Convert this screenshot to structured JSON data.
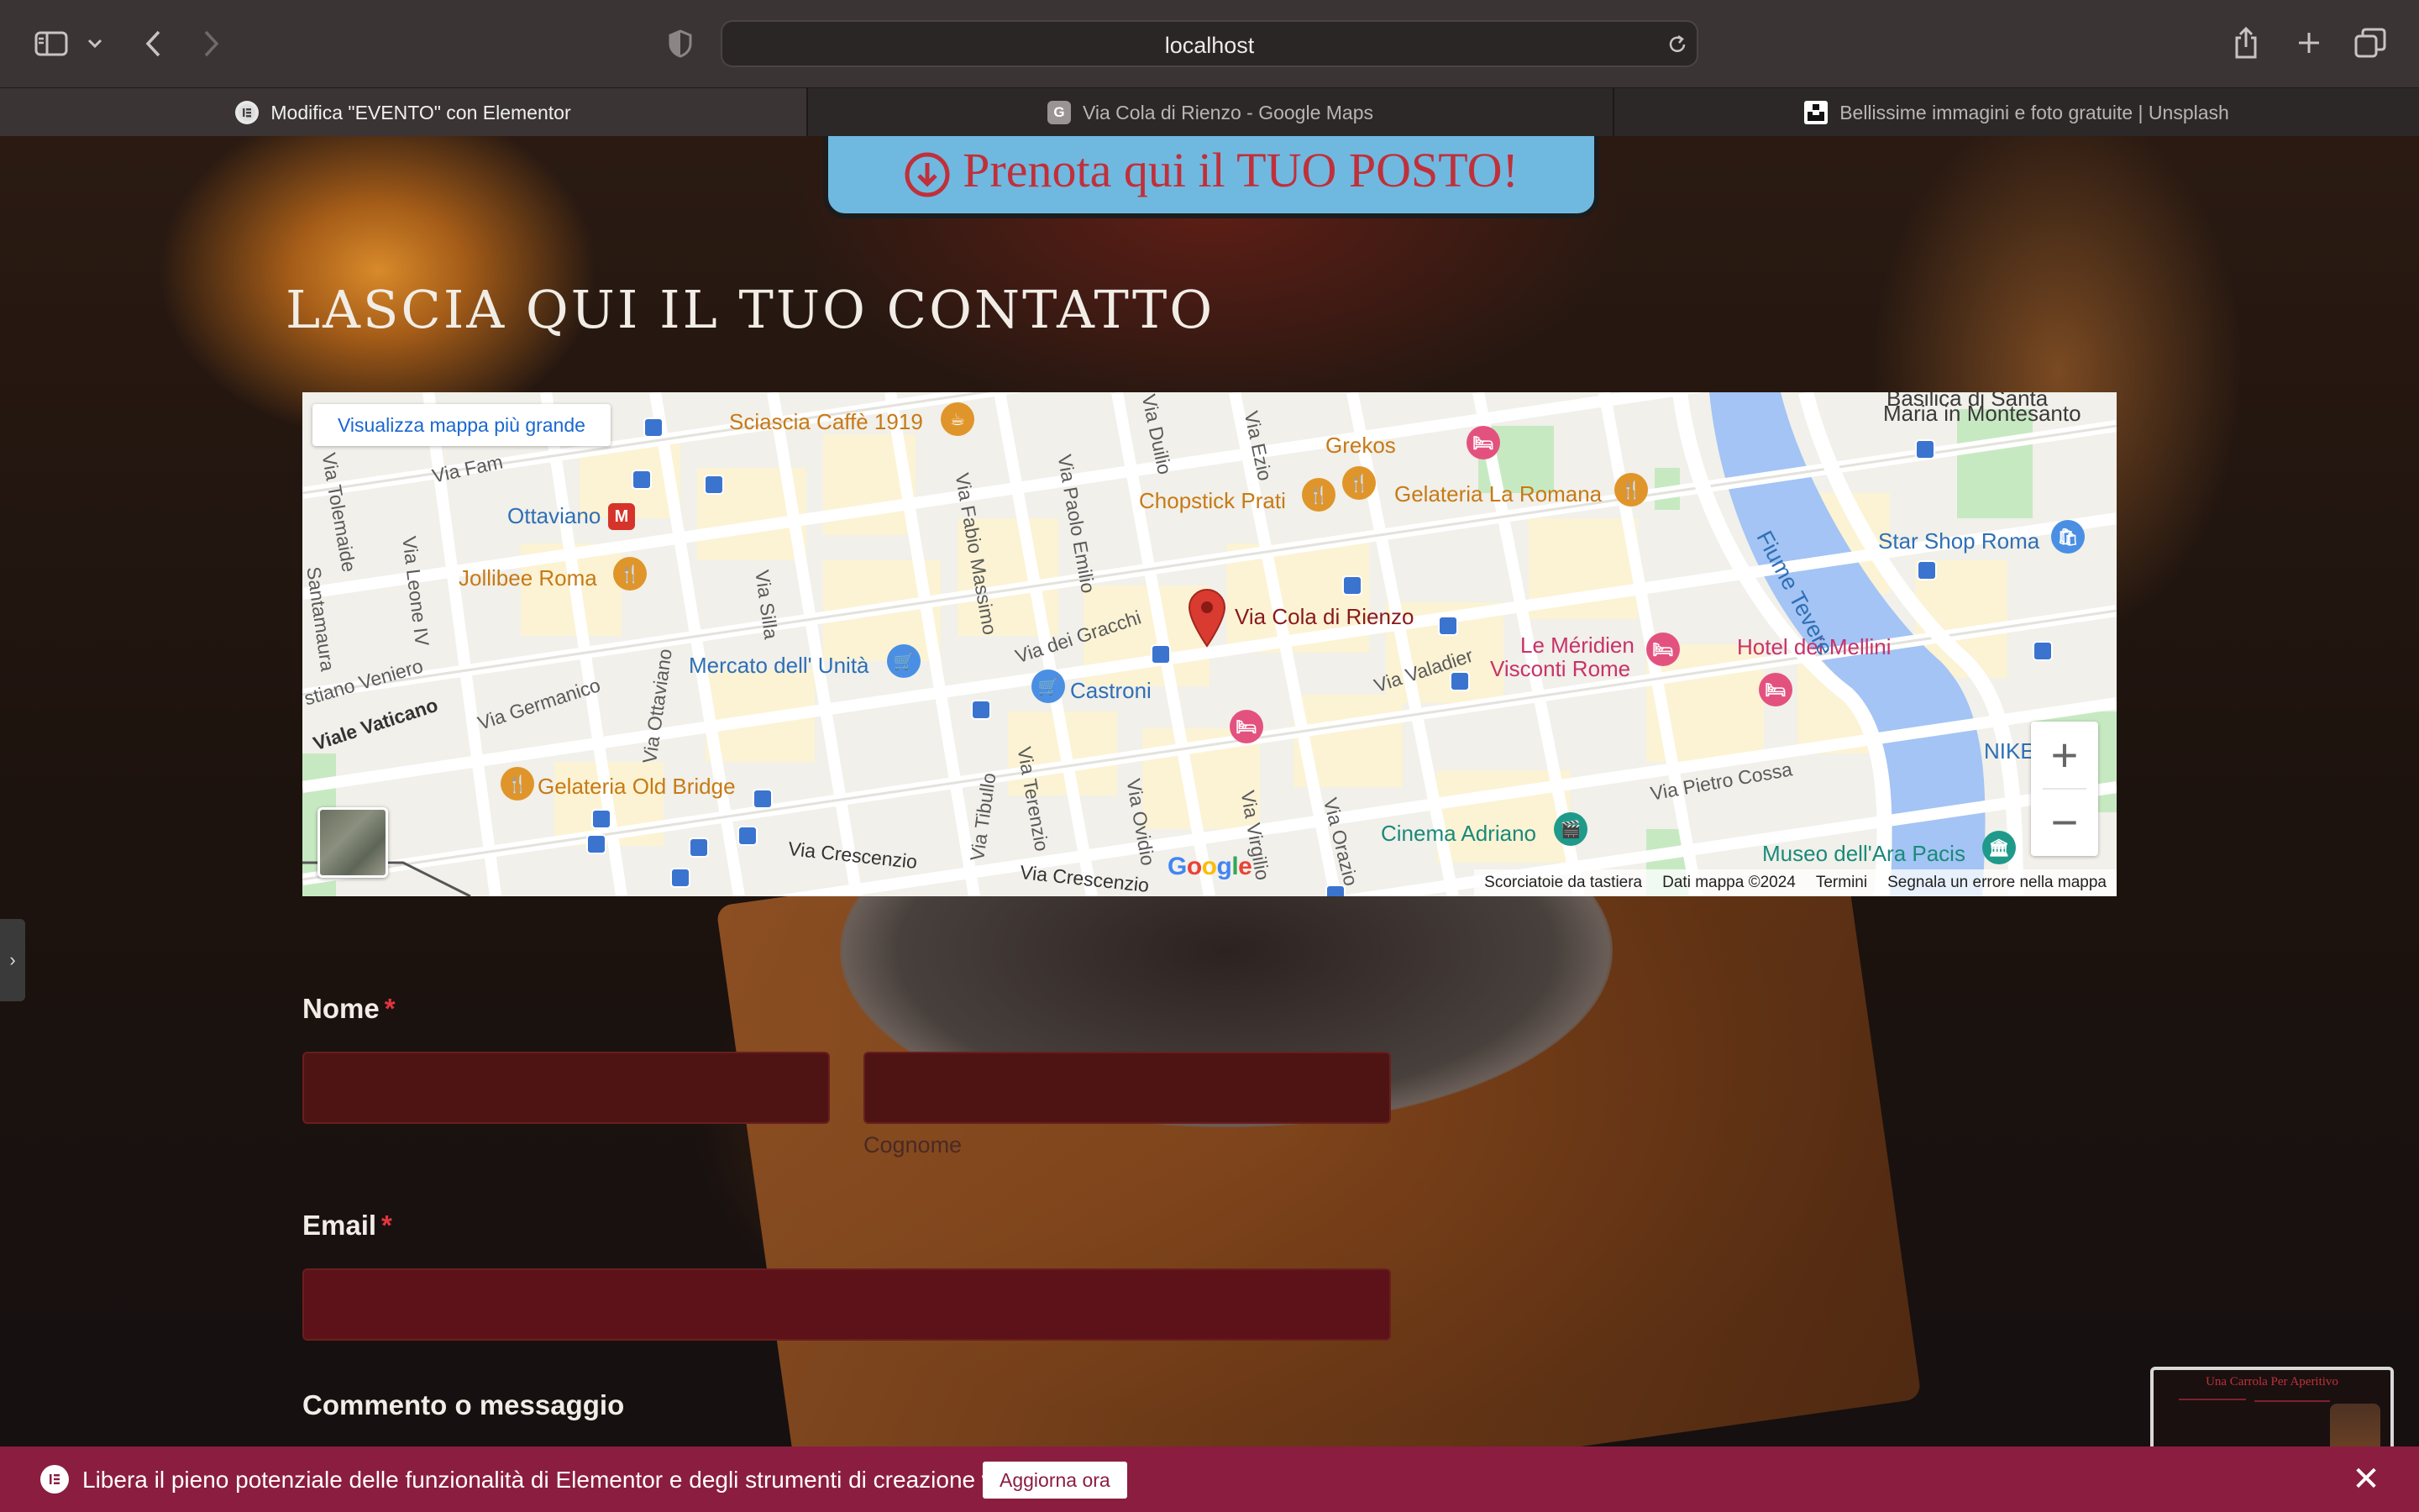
{
  "browser": {
    "url": "localhost",
    "tabs": [
      {
        "title": "Modifica \"EVENTO\" con Elementor",
        "favicon": "elementor-icon",
        "active": true
      },
      {
        "title": "Via Cola di Rienzo - Google Maps",
        "favicon": "G",
        "active": false
      },
      {
        "title": "Bellissime immagini e foto gratuite | Unsplash",
        "favicon": "unsplash-icon",
        "active": false
      }
    ],
    "icons": [
      "sidebar-icon",
      "chevron-down-icon",
      "back-icon",
      "forward-icon",
      "shield-icon",
      "reload-icon",
      "share-icon",
      "new-tab-icon",
      "tabs-overview-icon"
    ]
  },
  "page": {
    "booking_button_label": "Prenota qui il TUO POSTO!",
    "contact_heading": "LASCIA QUI IL TUO CONTATTO"
  },
  "map": {
    "view_larger_link": "Visualizza mappa più grande",
    "marker_label": "Via Cola di Rienzo",
    "logo": "Google",
    "footer": {
      "shortcuts": "Scorciatoie da tastiera",
      "data": "Dati mappa ©2024",
      "terms": "Termini",
      "report": "Segnala un errore nella mappa"
    },
    "places": {
      "sciascia": "Sciascia Caffè 1919",
      "grekos": "Grekos",
      "chopstick": "Chopstick Prati",
      "gelateria_romana": "Gelateria La Romana",
      "ottaviano": "Ottaviano",
      "jollibee": "Jollibee Roma",
      "mercato": "Mercato dell' Unità",
      "castroni": "Castroni",
      "meridien": "Le Méridien",
      "meridien2": "Visconti Rome",
      "mellini": "Hotel dei Mellini",
      "star_shop": "Star Shop Roma",
      "gelateria_old": "Gelateria Old Bridge",
      "cinema": "Cinema Adriano",
      "museo": "Museo dell'Ara Pacis",
      "basilica": "Basilica di Santa",
      "basilica2": "Maria in Montesanto",
      "nike": "NIKE",
      "fiume": "Fiume Tevere"
    },
    "streets": {
      "via_leone": "Via Leone IV",
      "via_tolemaide": "Via Tolemaide",
      "santamaura": "Santamaura",
      "via_fabio_massimo": "Via Fabio Massimo",
      "via_paolo_emilio": "Via Paolo Emilio",
      "via_duilio": "Via Duilio",
      "via_ezio": "Via Ezio",
      "via_silla": "Via Silla",
      "via_dei_gracchi": "Via dei Gracchi",
      "via_valadier": "Via Valadier",
      "via_ottaviano": "Via Ottaviano",
      "viale_vaticano": "Viale Vaticano",
      "via_germanico": "Via Germanico",
      "veniero": "stiano Veniero",
      "via_tibullo": "Via Tibullo",
      "via_terenzio": "Via Terenzio",
      "via_ovidio": "Via Ovidio",
      "via_virgilio": "Via Virgilio",
      "via_orazio": "Via Orazio",
      "via_crescenzio": "Via Crescenzio",
      "via_crescenzio2": "Via Crescenzio",
      "via_pietro_cossa": "Via Pietro Cossa",
      "via_fam": "Via Fam"
    }
  },
  "form": {
    "name_label": "Nome",
    "required_mark": "*",
    "surname_sublabel": "Cognome",
    "email_label": "Email",
    "message_label": "Commento o messaggio"
  },
  "promo": {
    "text": "Libera il pieno potenziale delle funzionalità di Elementor e degli strumenti di creazione web.",
    "button": "Aggiorna ora",
    "close": "✕"
  },
  "preview": {
    "title": "Una Carrola Per Aperitivo"
  },
  "colors": {
    "accent": "#8b1d41",
    "button_blue": "#6fb9e0",
    "button_text": "#c0303a",
    "input_bg": "#4e1414",
    "map_link": "#1a67d2"
  }
}
